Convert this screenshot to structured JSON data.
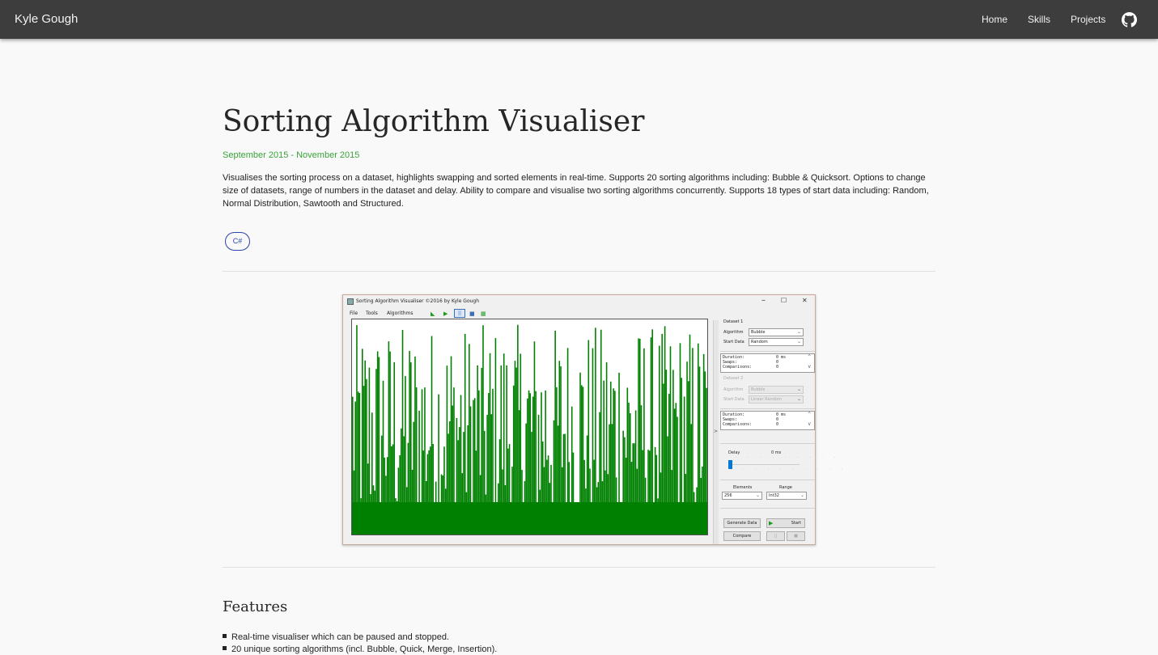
{
  "navbar": {
    "brand": "Kyle Gough",
    "links": [
      "Home",
      "Skills",
      "Projects"
    ],
    "github_icon": "github-icon"
  },
  "project": {
    "title": "Sorting Algorithm Visualiser",
    "dates": "September 2015 - November 2015",
    "description": "Visualises the sorting process on a dataset, highlights swapping and sorted elements in real-time. Supports 20 sorting algorithms including: Bubble & Quicksort. Options to change size of datasets, range of numbers in the dataset and delay. Ability to compare and visualise two sorting algorithms concurrently. Supports 18 types of start data including: Random, Normal Distribution, Sawtooth and Structured.",
    "tags": [
      "C#"
    ],
    "accent_color": "#3aa33a",
    "tag_color": "#2b45a8"
  },
  "app": {
    "title": "Sorting Algorithm Visualiser ©2016 by Kyle Gough",
    "window_buttons": [
      "–",
      "☐",
      "✕"
    ],
    "menus": [
      "File",
      "Tools",
      "Algorithms"
    ],
    "toolbar_icons": [
      "step-icon",
      "play-icon",
      "pause-icon",
      "stop-icon",
      "calendar-icon"
    ],
    "bar_color": "#008000",
    "dataset1": {
      "heading": "Dataset 1",
      "algorithm_label": "Algorithm",
      "algorithm": "Bubble",
      "start_data_label": "Start Data",
      "start_data": "Random",
      "stats": [
        {
          "label": "Duration:",
          "value": "0 ms"
        },
        {
          "label": "Swaps:",
          "value": "0"
        },
        {
          "label": "Comparisons:",
          "value": "0"
        }
      ]
    },
    "dataset2": {
      "heading": "Dataset 2",
      "algorithm_label": "Algorithm",
      "algorithm": "Bubble",
      "start_data_label": "Start Data",
      "start_data": "Linear Random",
      "stats": [
        {
          "label": "Duration:",
          "value": "0 ms"
        },
        {
          "label": "Swaps:",
          "value": "0"
        },
        {
          "label": "Comparisons:",
          "value": "0"
        }
      ]
    },
    "delay_label": "Delay",
    "delay_value": "0 ms",
    "elements_label": "Elements",
    "elements": "256",
    "range_label": "Range",
    "range": "Int32",
    "buttons": {
      "generate": "Generate Data",
      "start": "Start",
      "compare": "Compare",
      "pause": "||",
      "stop": "■"
    },
    "splitter_arrow": ">"
  },
  "features": {
    "heading": "Features",
    "items": [
      "Real-time visualiser which can be paused and stopped.",
      "20 unique sorting algorithms (incl. Bubble, Quick, Merge, Insertion)."
    ]
  }
}
